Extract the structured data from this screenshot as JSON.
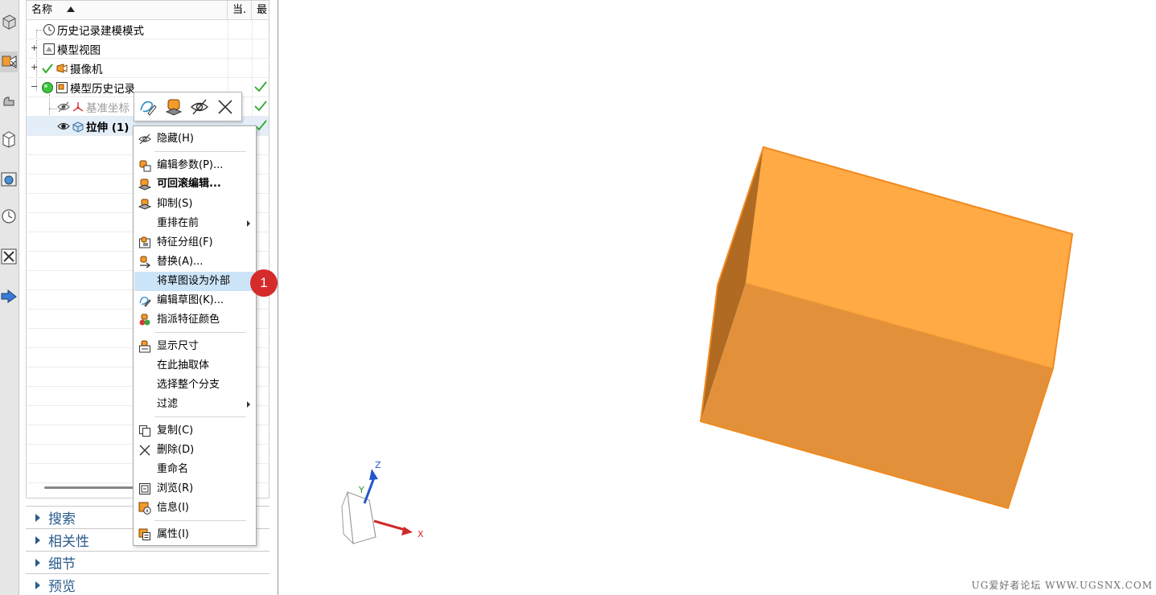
{
  "navigator": {
    "columns": {
      "name": "名称",
      "current": "当.",
      "latest": "最"
    },
    "nodes": [
      {
        "label": "历史记录建模模式"
      },
      {
        "label": "模型视图"
      },
      {
        "label": "摄像机"
      },
      {
        "label": "模型历史记录"
      },
      {
        "label": "基准坐标"
      },
      {
        "label": "拉伸 (1)"
      }
    ],
    "sections": [
      "搜索",
      "相关性",
      "细节",
      "预览"
    ]
  },
  "context_menu": {
    "items": [
      {
        "label": "隐藏(H)",
        "icon": "hide-icon"
      },
      {
        "label": "编辑参数(P)...",
        "icon": "edit-parameters-icon"
      },
      {
        "label": "可回滚编辑...",
        "icon": "rollback-edit-icon",
        "bold": true
      },
      {
        "label": "抑制(S)",
        "icon": "suppress-icon"
      },
      {
        "label": "重排在前",
        "submenu": true
      },
      {
        "label": "特征分组(F)",
        "icon": "feature-group-icon"
      },
      {
        "label": "替换(A)...",
        "icon": "replace-icon"
      },
      {
        "label": "将草图设为外部",
        "highlighted": true
      },
      {
        "label": "编辑草图(K)...",
        "icon": "edit-sketch-icon"
      },
      {
        "label": "指派特征颜色",
        "icon": "feature-color-icon"
      },
      {
        "label": "显示尺寸",
        "icon": "show-dimensions-icon"
      },
      {
        "label": "在此抽取体"
      },
      {
        "label": "选择整个分支"
      },
      {
        "label": "过滤",
        "submenu": true
      },
      {
        "label": "复制(C)",
        "icon": "copy-icon"
      },
      {
        "label": "删除(D)",
        "icon": "delete-icon"
      },
      {
        "label": "重命名"
      },
      {
        "label": "浏览(R)",
        "icon": "browse-icon"
      },
      {
        "label": "信息(I)",
        "icon": "info-icon"
      },
      {
        "label": "属性(I)",
        "icon": "properties-icon"
      }
    ]
  },
  "callout": {
    "number": "1"
  },
  "triad": {
    "z": "Z",
    "y": "Y",
    "x": "X"
  },
  "viewport": {
    "body_color": "#ffaa44",
    "watermark": "UG爱好者论坛 WWW.UGSNX.COM"
  }
}
